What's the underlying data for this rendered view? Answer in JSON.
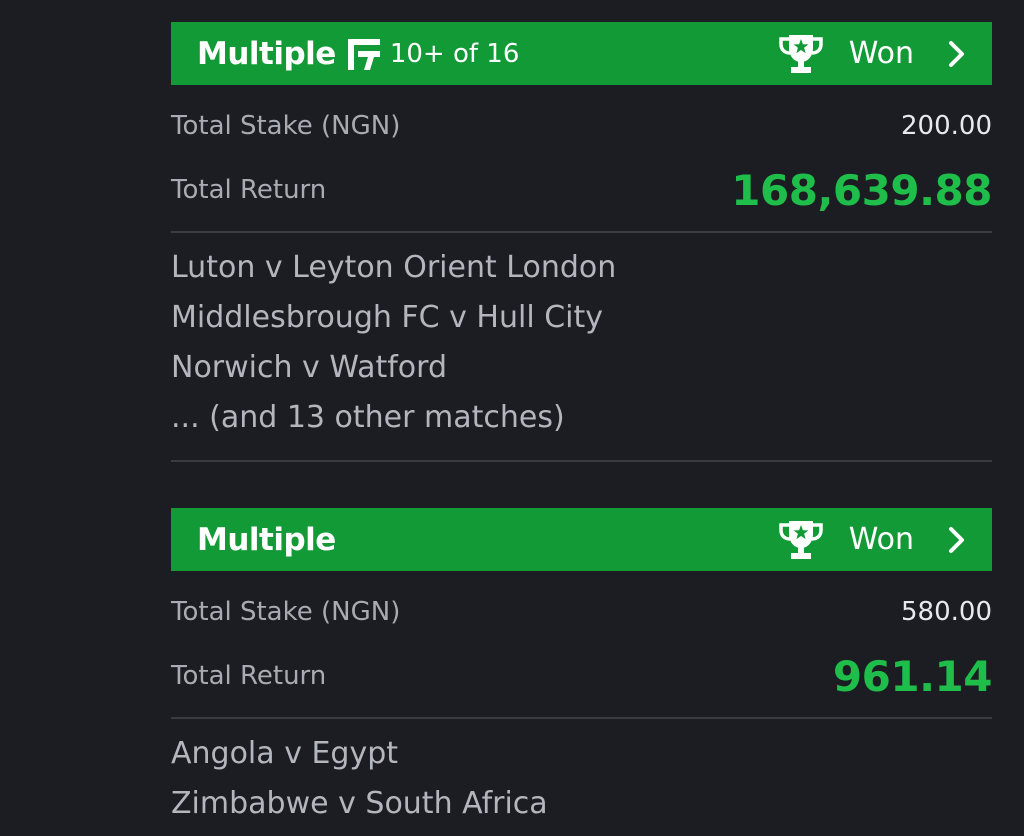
{
  "tickets": [
    {
      "type_label": "Multiple",
      "flex_label": "10+ of 16",
      "status": "Won",
      "stake_label": "Total Stake (NGN)",
      "stake_value": "200.00",
      "return_label": "Total Return",
      "return_value": "168,639.88",
      "matches": [
        "Luton v Leyton Orient London",
        "Middlesbrough FC v Hull City",
        "Norwich v Watford",
        "... (and 13 other matches)"
      ]
    },
    {
      "type_label": "Multiple",
      "status": "Won",
      "stake_label": "Total Stake (NGN)",
      "stake_value": "580.00",
      "return_label": "Total Return",
      "return_value": "961.14",
      "matches": [
        "Angola v Egypt",
        "Zimbabwe v South Africa"
      ]
    }
  ],
  "icons": {
    "flex": "flex-f-icon",
    "trophy": "trophy-star-icon",
    "chevron": "chevron-right-icon"
  },
  "colors": {
    "background": "#1b1d23",
    "header_green": "#119a35",
    "return_green": "#1fbe4a",
    "divider": "#3a3c43"
  }
}
